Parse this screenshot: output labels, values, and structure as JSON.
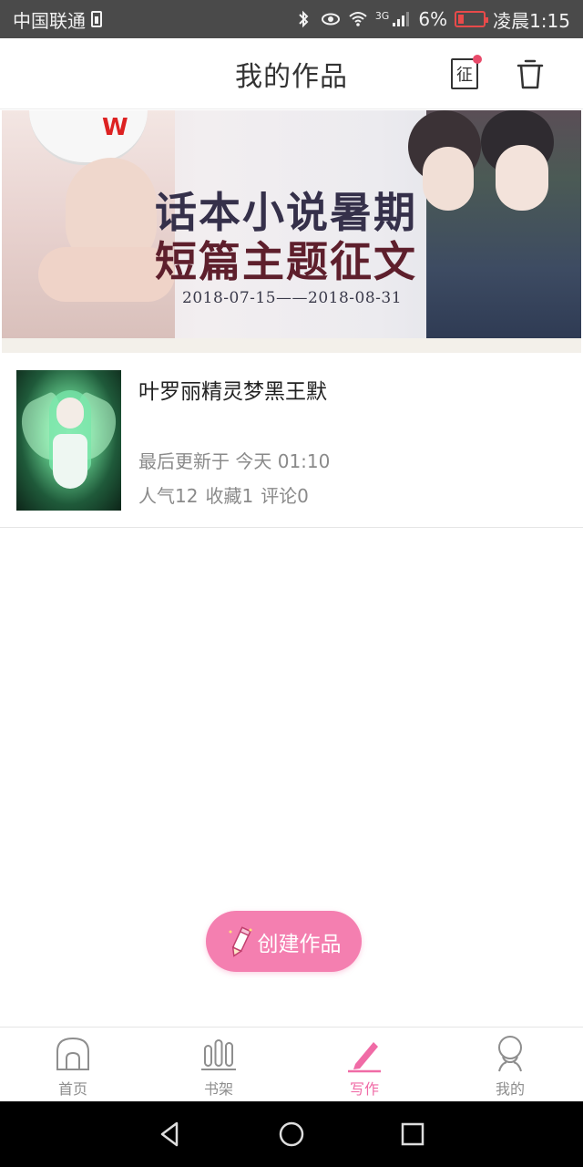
{
  "status_bar": {
    "carrier": "中国联通",
    "signal_type": "3G",
    "battery_percent": "6%",
    "time": "凌晨1:15"
  },
  "header": {
    "title": "我的作品",
    "contest_badge_char": "征"
  },
  "banner": {
    "title_line1": "话本小说暑期",
    "title_line2": "短篇主题征文",
    "date_range": "2018-07-15——2018-08-31",
    "cap_letter": "W"
  },
  "works": [
    {
      "title": "叶罗丽精灵梦黑王默",
      "updated": "最后更新于 今天 01:10",
      "popularity": "人气12",
      "favorites": "收藏1",
      "comments": "评论0"
    }
  ],
  "create_button": {
    "label": "创建作品"
  },
  "tabs": [
    {
      "label": "首页",
      "icon": "home-icon",
      "active": false
    },
    {
      "label": "书架",
      "icon": "bookshelf-icon",
      "active": false
    },
    {
      "label": "写作",
      "icon": "write-pencil-icon",
      "active": true
    },
    {
      "label": "我的",
      "icon": "profile-icon",
      "active": false
    }
  ],
  "colors": {
    "accent_pink": "#f06ba6",
    "create_button": "#f47fb0",
    "status_bar": "#4a4a4a",
    "battery_low": "#e84a4a"
  }
}
